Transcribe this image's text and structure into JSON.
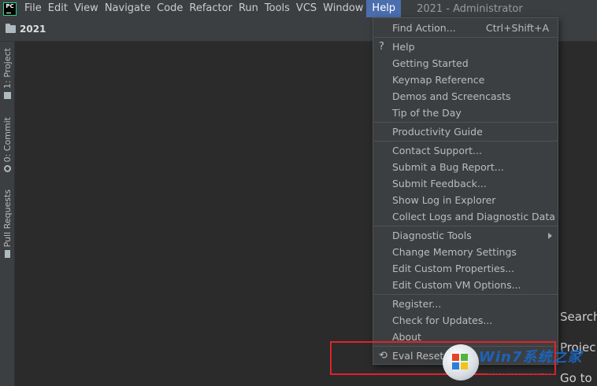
{
  "app": {
    "logo_text": "PC"
  },
  "menubar": {
    "items": [
      "File",
      "Edit",
      "View",
      "Navigate",
      "Code",
      "Refactor",
      "Run",
      "Tools",
      "VCS",
      "Window",
      "Help"
    ],
    "active": "Help",
    "window_title": "2021 - Administrator"
  },
  "navbar": {
    "project": "2021"
  },
  "toolstrip": {
    "tabs": [
      "1: Project",
      "0: Commit",
      "Pull Requests"
    ]
  },
  "editor": {
    "hints": [
      "Search",
      "Projec",
      "Go to"
    ]
  },
  "help_menu": {
    "find_action": "Find Action...",
    "find_action_shortcut": "Ctrl+Shift+A",
    "help": "Help",
    "getting_started": "Getting Started",
    "keymap_reference": "Keymap Reference",
    "demos": "Demos and Screencasts",
    "tip_of_day": "Tip of the Day",
    "productivity_guide": "Productivity Guide",
    "contact_support": "Contact Support...",
    "submit_bug": "Submit a Bug Report...",
    "submit_feedback": "Submit Feedback...",
    "show_log": "Show Log in Explorer",
    "collect_logs": "Collect Logs and Diagnostic Data",
    "diagnostic_tools": "Diagnostic Tools",
    "change_memory": "Change Memory Settings",
    "edit_properties": "Edit Custom Properties...",
    "edit_vm_options": "Edit Custom VM Options...",
    "register": "Register...",
    "check_updates": "Check for Updates...",
    "about": "About",
    "eval_reset": "Eval Reset",
    "help_icon_glyph": "?",
    "eval_reset_icon_glyph": "⟲"
  },
  "watermark": {
    "brand": "Win7系统之家",
    "url": "www.Winwin7.com"
  },
  "colors": {
    "menu_active": "#4b6eaf",
    "highlight_border": "#e0232a"
  }
}
